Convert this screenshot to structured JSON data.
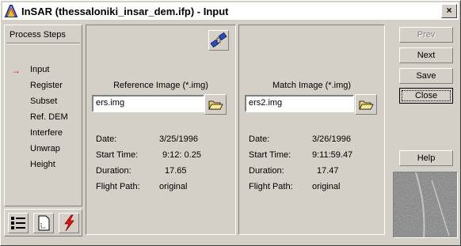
{
  "window": {
    "title": "InSAR (thessaloniki_insar_dem.ifp) - Input",
    "close_glyph": "×"
  },
  "steps": {
    "header": "Process Steps",
    "items": [
      "Input",
      "Register",
      "Subset",
      "Ref. DEM",
      "Interfere",
      "Unwrap",
      "Height"
    ],
    "current_marker": "→"
  },
  "reference": {
    "label": "Reference Image (*.img)",
    "file": "ers.img",
    "date_label": "Date:",
    "date": "3/25/1996",
    "start_label": "Start Time:",
    "start": "9:12: 0.25",
    "duration_label": "Duration:",
    "duration": "17.65",
    "flight_label": "Flight Path:",
    "flight": "original"
  },
  "match": {
    "label": "Match Image (*.img)",
    "file": "ers2.img",
    "date_label": "Date:",
    "date": "3/26/1996",
    "start_label": "Start Time:",
    "start": "9:11:59.47",
    "duration_label": "Duration:",
    "duration": "17.47",
    "flight_label": "Flight Path:",
    "flight": "original"
  },
  "buttons": {
    "prev": "Prev",
    "next": "Next",
    "save": "Save",
    "close": "Close",
    "help": "Help"
  },
  "icons": {
    "app": "insar-app-icon",
    "satellite": "satellite-icon",
    "browse": "folder-open-icon",
    "list": "list-view-icon",
    "page": "page-icon",
    "run": "lightning-icon"
  },
  "colors": {
    "face": "#d4d0c8",
    "arrow": "#e01818"
  }
}
